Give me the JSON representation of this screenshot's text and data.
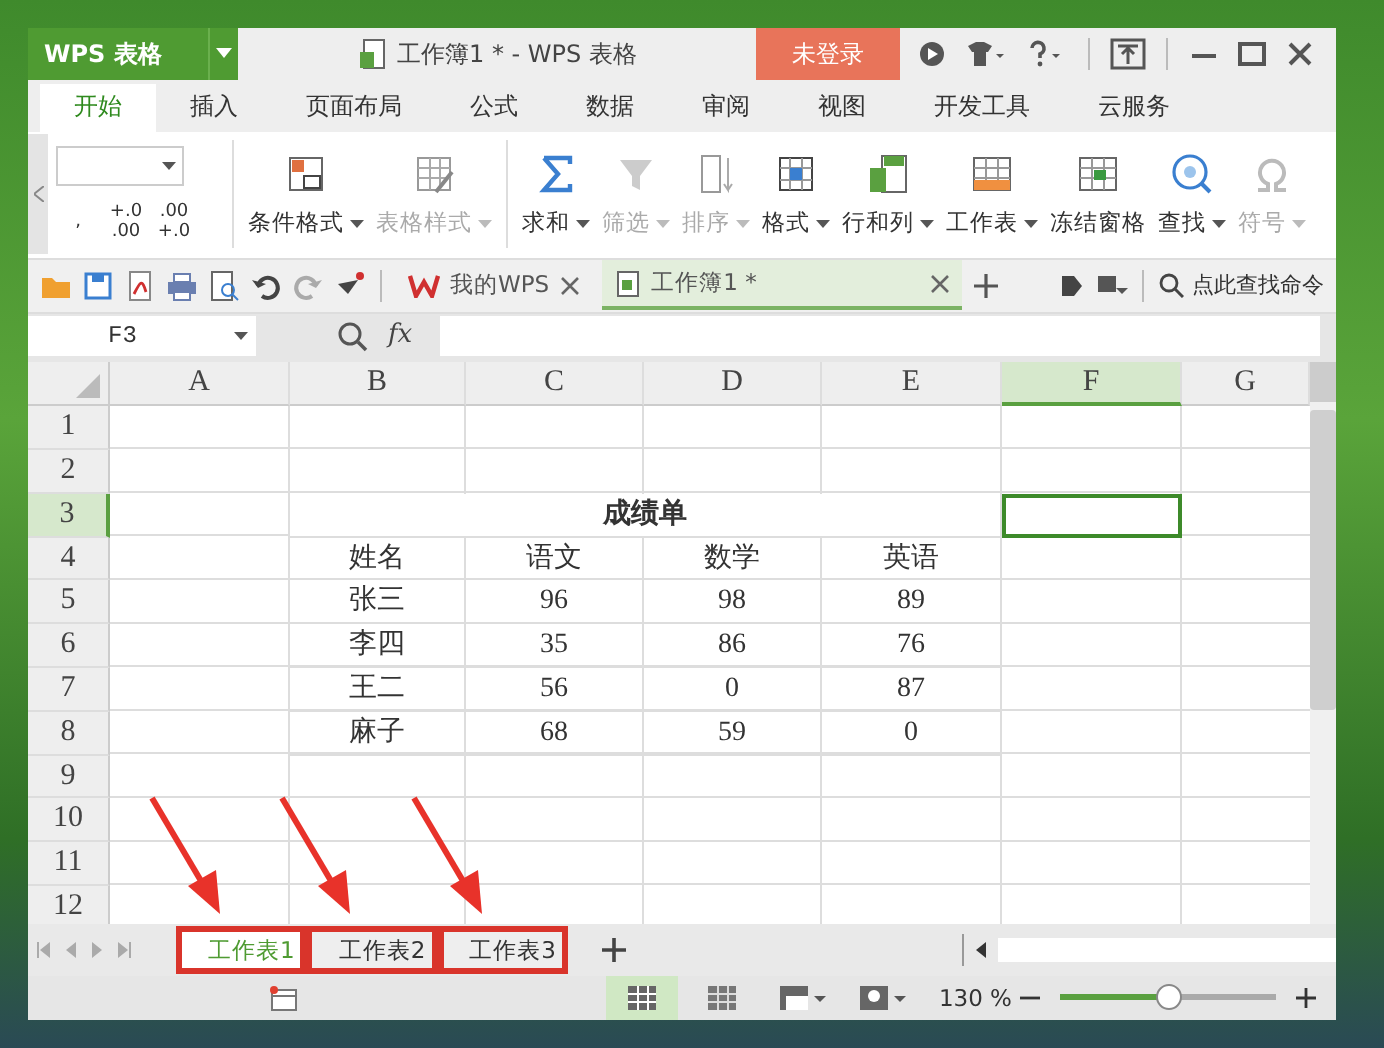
{
  "window": {
    "app_button": "WPS 表格",
    "title": "工作簿1 * - WPS 表格",
    "login_button": "未登录"
  },
  "menu_tabs": [
    {
      "label": "开始",
      "selected": true
    },
    {
      "label": "插入",
      "selected": false
    },
    {
      "label": "页面布局",
      "selected": false
    },
    {
      "label": "公式",
      "selected": false
    },
    {
      "label": "数据",
      "selected": false
    },
    {
      "label": "审阅",
      "selected": false
    },
    {
      "label": "视图",
      "selected": false
    },
    {
      "label": "开发工具",
      "selected": false
    },
    {
      "label": "云服务",
      "selected": false
    }
  ],
  "ribbon": {
    "small_buttons": [
      ",",
      "+.0 .00",
      ".00 +.0"
    ],
    "buttons": [
      {
        "label": "条件格式",
        "dropdown": true,
        "disabled": false
      },
      {
        "label": "表格样式",
        "dropdown": true,
        "disabled": true
      },
      {
        "label": "求和",
        "dropdown": true,
        "disabled": false
      },
      {
        "label": "筛选",
        "dropdown": true,
        "disabled": true
      },
      {
        "label": "排序",
        "dropdown": true,
        "disabled": true
      },
      {
        "label": "格式",
        "dropdown": true,
        "disabled": false
      },
      {
        "label": "行和列",
        "dropdown": true,
        "disabled": false
      },
      {
        "label": "工作表",
        "dropdown": true,
        "disabled": false
      },
      {
        "label": "冻结窗格",
        "dropdown": false,
        "disabled": false
      },
      {
        "label": "查找",
        "dropdown": true,
        "disabled": false
      },
      {
        "label": "符号",
        "dropdown": true,
        "disabled": true
      }
    ]
  },
  "doc_tabs": [
    {
      "label": "我的WPS",
      "selected": false
    },
    {
      "label": "工作簿1 *",
      "selected": true
    }
  ],
  "command_search": "点此查找命令",
  "formula_bar": {
    "name_box": "F3",
    "fx": "fx"
  },
  "columns": [
    {
      "label": "A",
      "selected": false
    },
    {
      "label": "B",
      "selected": false
    },
    {
      "label": "C",
      "selected": false
    },
    {
      "label": "D",
      "selected": false
    },
    {
      "label": "E",
      "selected": false
    },
    {
      "label": "F",
      "selected": true
    },
    {
      "label": "G",
      "selected": false
    }
  ],
  "rows": [
    {
      "number": "1",
      "selected": false
    },
    {
      "number": "2",
      "selected": false
    },
    {
      "number": "3",
      "selected": true,
      "title": "成绩单"
    },
    {
      "number": "4",
      "selected": false,
      "cells": [
        "姓名",
        "语文",
        "数学",
        "英语"
      ]
    },
    {
      "number": "5",
      "selected": false,
      "cells": [
        "张三",
        "96",
        "98",
        "89"
      ]
    },
    {
      "number": "6",
      "selected": false,
      "cells": [
        "李四",
        "35",
        "86",
        "76"
      ]
    },
    {
      "number": "7",
      "selected": false,
      "cells": [
        "王二",
        "56",
        "0",
        "87"
      ]
    },
    {
      "number": "8",
      "selected": false,
      "cells": [
        "麻子",
        "68",
        "59",
        "0"
      ]
    },
    {
      "number": "9",
      "selected": false
    },
    {
      "number": "10",
      "selected": false
    },
    {
      "number": "11",
      "selected": false
    },
    {
      "number": "12",
      "selected": false
    }
  ],
  "sheet_tabs": [
    {
      "label": "工作表1",
      "selected": true,
      "highlighted": true
    },
    {
      "label": "工作表2",
      "selected": false,
      "highlighted": true
    },
    {
      "label": "工作表3",
      "selected": false,
      "highlighted": true
    }
  ],
  "status_bar": {
    "zoom": "130 %",
    "zoom_slider": {
      "level": 0.5
    }
  }
}
